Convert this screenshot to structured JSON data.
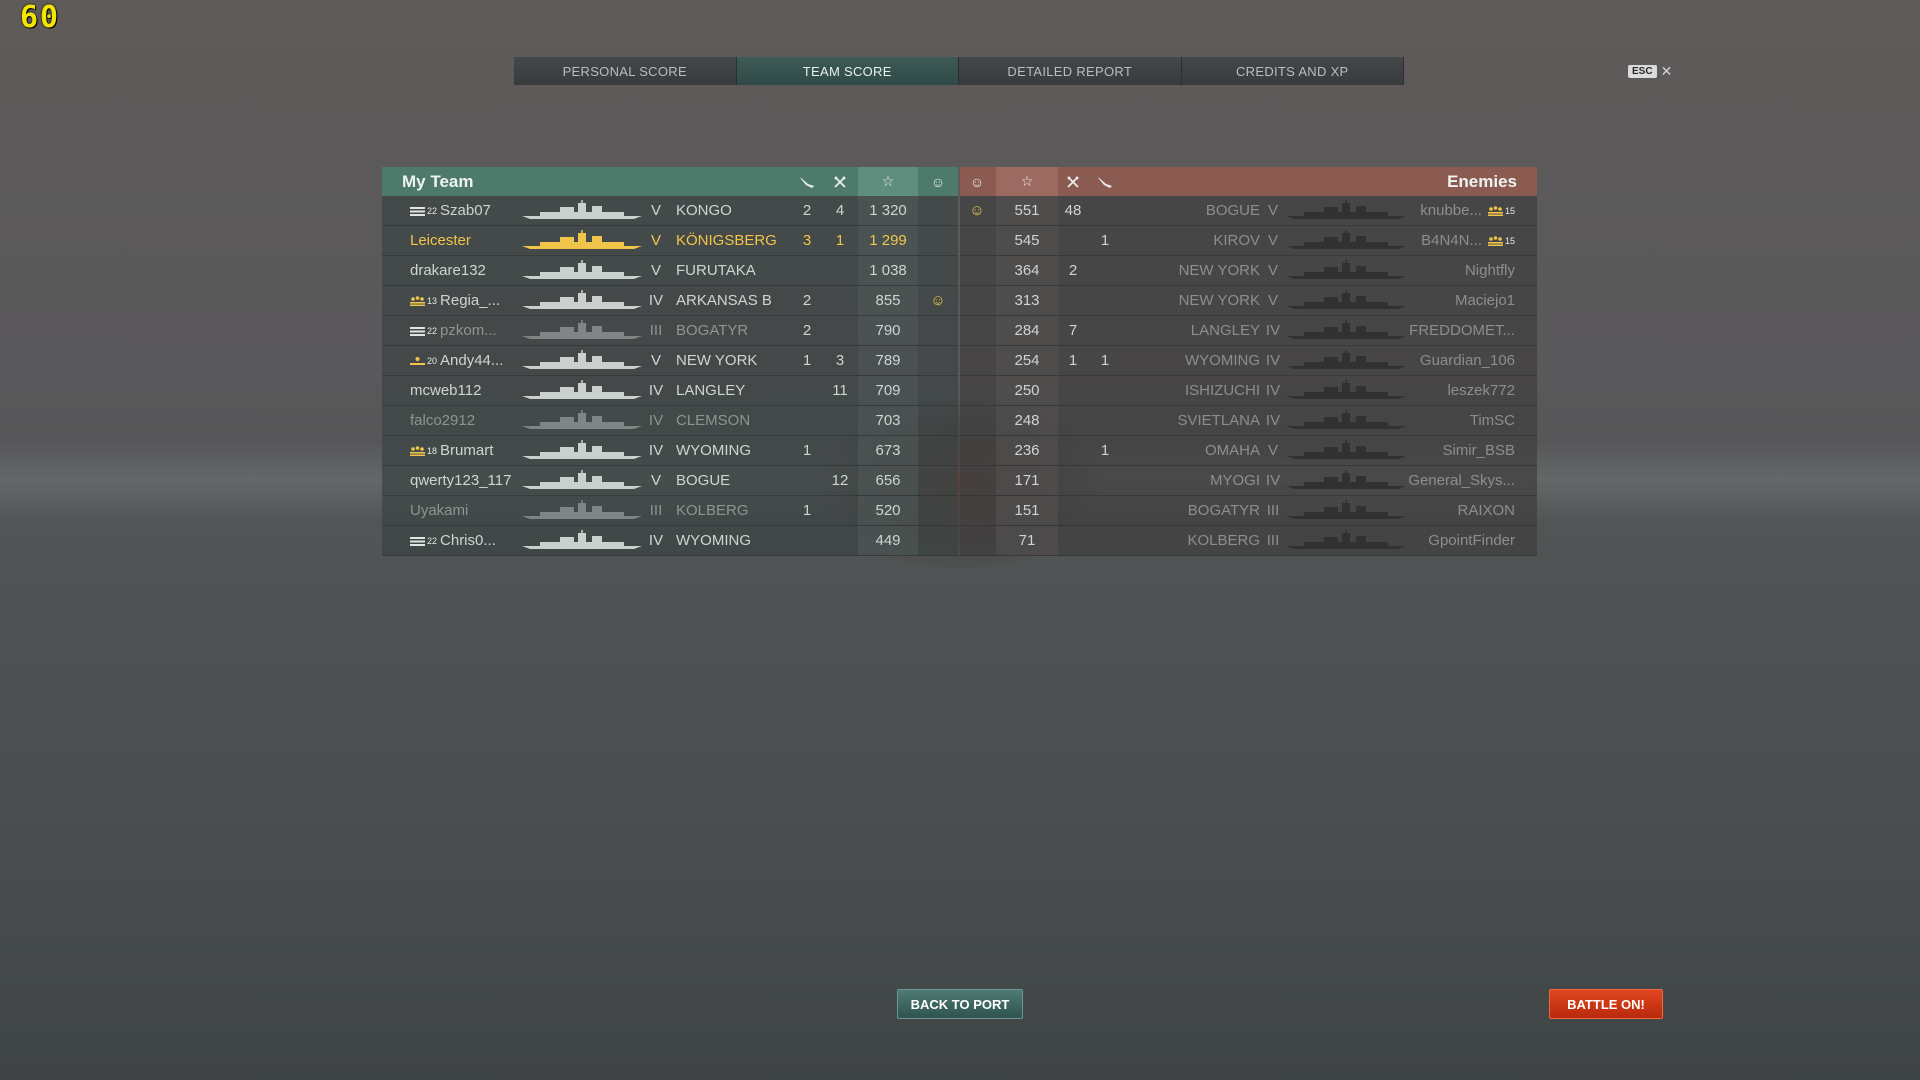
{
  "fps": "60",
  "tabs": [
    "PERSONAL SCORE",
    "TEAM SCORE",
    "DETAILED REPORT",
    "CREDITS AND XP"
  ],
  "active_tab": 1,
  "esc_label": "ESC",
  "my_team_title": "My Team",
  "enemies_title": "Enemies",
  "my_team": [
    {
      "badge": "22",
      "player": "Szab07",
      "tier": "V",
      "ship": "KONGO",
      "planes": "2",
      "frags": "4",
      "score": "1 320",
      "status": "",
      "dim": false,
      "hl": false,
      "rank": "bars"
    },
    {
      "badge": "",
      "player": "Leicester",
      "tier": "V",
      "ship": "KÖNIGSBERG",
      "planes": "3",
      "frags": "1",
      "score": "1 299",
      "status": "",
      "dim": false,
      "hl": true,
      "rank": ""
    },
    {
      "badge": "",
      "player": "drakare132",
      "tier": "V",
      "ship": "FURUTAKA",
      "planes": "",
      "frags": "",
      "score": "1 038",
      "status": "",
      "dim": false,
      "hl": false,
      "rank": ""
    },
    {
      "badge": "13",
      "player": "Regia_...",
      "tier": "IV",
      "ship": "ARKANSAS B",
      "planes": "2",
      "frags": "",
      "score": "855",
      "status": "smile",
      "dim": false,
      "hl": false,
      "rank": "stars"
    },
    {
      "badge": "22",
      "player": "pzkom...",
      "tier": "III",
      "ship": "BOGATYR",
      "planes": "2",
      "frags": "",
      "score": "790",
      "status": "",
      "dim": true,
      "hl": false,
      "rank": "bars"
    },
    {
      "badge": "20",
      "player": "Andy44...",
      "tier": "V",
      "ship": "NEW YORK",
      "planes": "1",
      "frags": "3",
      "score": "789",
      "status": "",
      "dim": false,
      "hl": false,
      "rank": "star1"
    },
    {
      "badge": "",
      "player": "mcweb112",
      "tier": "IV",
      "ship": "LANGLEY",
      "planes": "",
      "frags": "11",
      "score": "709",
      "status": "",
      "dim": false,
      "hl": false,
      "rank": ""
    },
    {
      "badge": "",
      "player": "falco2912",
      "tier": "IV",
      "ship": "CLEMSON",
      "planes": "",
      "frags": "",
      "score": "703",
      "status": "",
      "dim": true,
      "hl": false,
      "rank": ""
    },
    {
      "badge": "18",
      "player": "Brumart",
      "tier": "IV",
      "ship": "WYOMING",
      "planes": "1",
      "frags": "",
      "score": "673",
      "status": "",
      "dim": false,
      "hl": false,
      "rank": "stars"
    },
    {
      "badge": "",
      "player": "qwerty123_117",
      "tier": "V",
      "ship": "BOGUE",
      "planes": "",
      "frags": "12",
      "score": "656",
      "status": "",
      "dim": false,
      "hl": false,
      "rank": ""
    },
    {
      "badge": "",
      "player": "Uyakami",
      "tier": "III",
      "ship": "KOLBERG",
      "planes": "1",
      "frags": "",
      "score": "520",
      "status": "",
      "dim": true,
      "hl": false,
      "rank": ""
    },
    {
      "badge": "22",
      "player": "Chris0...",
      "tier": "IV",
      "ship": "WYOMING",
      "planes": "",
      "frags": "",
      "score": "449",
      "status": "",
      "dim": false,
      "hl": false,
      "rank": "bars"
    }
  ],
  "enemies": [
    {
      "status": "smile",
      "score": "551",
      "frags": "48",
      "planes": "",
      "ship": "BOGUE",
      "tier": "V",
      "player": "knubbe...",
      "badge": "15",
      "rank": "stars"
    },
    {
      "status": "",
      "score": "545",
      "frags": "",
      "planes": "1",
      "ship": "KIROV",
      "tier": "V",
      "player": "B4N4N...",
      "badge": "15",
      "rank": "stars"
    },
    {
      "status": "",
      "score": "364",
      "frags": "2",
      "planes": "",
      "ship": "NEW YORK",
      "tier": "V",
      "player": "Nightfly",
      "badge": "",
      "rank": ""
    },
    {
      "status": "",
      "score": "313",
      "frags": "",
      "planes": "",
      "ship": "NEW YORK",
      "tier": "V",
      "player": "Maciejo1",
      "badge": "",
      "rank": ""
    },
    {
      "status": "",
      "score": "284",
      "frags": "7",
      "planes": "",
      "ship": "LANGLEY",
      "tier": "IV",
      "player": "FREDDOMET...",
      "badge": "",
      "rank": ""
    },
    {
      "status": "",
      "score": "254",
      "frags": "1",
      "planes": "1",
      "ship": "WYOMING",
      "tier": "IV",
      "player": "Guardian_106",
      "badge": "",
      "rank": ""
    },
    {
      "status": "",
      "score": "250",
      "frags": "",
      "planes": "",
      "ship": "ISHIZUCHI",
      "tier": "IV",
      "player": "leszek772",
      "badge": "",
      "rank": ""
    },
    {
      "status": "",
      "score": "248",
      "frags": "",
      "planes": "",
      "ship": "SVIETLANA",
      "tier": "IV",
      "player": "TimSC",
      "badge": "",
      "rank": ""
    },
    {
      "status": "",
      "score": "236",
      "frags": "",
      "planes": "1",
      "ship": "OMAHA",
      "tier": "V",
      "player": "Simir_BSB",
      "badge": "",
      "rank": ""
    },
    {
      "status": "",
      "score": "171",
      "frags": "",
      "planes": "",
      "ship": "MYOGI",
      "tier": "IV",
      "player": "General_Skys...",
      "badge": "",
      "rank": ""
    },
    {
      "status": "",
      "score": "151",
      "frags": "",
      "planes": "",
      "ship": "BOGATYR",
      "tier": "III",
      "player": "RAIXON",
      "badge": "",
      "rank": ""
    },
    {
      "status": "",
      "score": "71",
      "frags": "",
      "planes": "",
      "ship": "KOLBERG",
      "tier": "III",
      "player": "GpointFinder",
      "badge": "",
      "rank": ""
    }
  ],
  "buttons": {
    "back_to_port": "BACK TO PORT",
    "battle_on": "BATTLE ON!"
  },
  "colors": {
    "highlight": "#f0c54a",
    "my_team_header": "#4d7a6a",
    "enemies_header": "#8b5a50",
    "fps": "#f3e600",
    "battle_button": "#d23a16"
  },
  "icons": {
    "header": [
      "plane-icon",
      "sword-icon",
      "star-icon",
      "smiley-icon"
    ]
  }
}
